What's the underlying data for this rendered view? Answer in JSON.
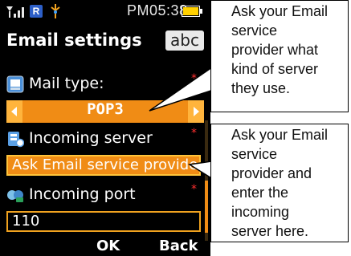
{
  "status_bar": {
    "time": "PM05:38",
    "badge": "R",
    "icons": [
      "signal-icon",
      "roaming-icon",
      "antenna-icon",
      "battery-icon"
    ]
  },
  "header": {
    "title": "Email settings",
    "input_mode": "abc"
  },
  "fields": {
    "mail_type": {
      "label": "Mail type:",
      "value": "POP3"
    },
    "incoming_server": {
      "label": "Incoming server",
      "value": "Ask Email service provider"
    },
    "incoming_port": {
      "label": "Incoming port",
      "value": "110"
    }
  },
  "softkeys": {
    "left": "OK",
    "right": "Back"
  },
  "callouts": [
    {
      "lines": [
        "Ask your Email",
        "service",
        "provider what",
        "kind of server",
        "they use."
      ]
    },
    {
      "lines": [
        "Ask your Email",
        "service",
        "provider and",
        "enter the",
        "incoming",
        "server here."
      ]
    }
  ],
  "colors": {
    "accent": "#f08c15",
    "background": "#000000",
    "required": "#ff3030"
  }
}
